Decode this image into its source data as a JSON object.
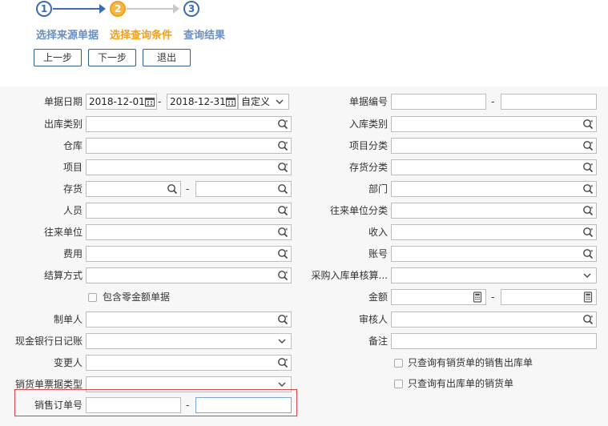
{
  "wizard": {
    "steps": [
      {
        "num": "1",
        "label": "选择来源单据"
      },
      {
        "num": "2",
        "label": "选择查询条件"
      },
      {
        "num": "3",
        "label": "查询结果"
      }
    ],
    "buttons": {
      "prev": "上一步",
      "next": "下一步",
      "exit": "退出"
    }
  },
  "form": {
    "doc_date": {
      "label": "单据日期",
      "from": "2018-12-01",
      "to": "2018-12-31",
      "mode": "自定义",
      "dash": "-"
    },
    "doc_no": {
      "label": "单据编号",
      "dash": "-"
    },
    "out_type": {
      "label": "出库类别"
    },
    "in_type": {
      "label": "入库类别"
    },
    "warehouse": {
      "label": "仓库"
    },
    "project_class": {
      "label": "项目分类"
    },
    "project": {
      "label": "项目"
    },
    "inventory_class": {
      "label": "存货分类"
    },
    "inventory": {
      "label": "存货",
      "dash": "-"
    },
    "department": {
      "label": "部门"
    },
    "person": {
      "label": "人员"
    },
    "partner_class": {
      "label": "往来单位分类"
    },
    "partner": {
      "label": "往来单位"
    },
    "income": {
      "label": "收入"
    },
    "expense": {
      "label": "费用"
    },
    "account": {
      "label": "账号"
    },
    "settle": {
      "label": "结算方式"
    },
    "purchase_check": {
      "label": "采购入库单核算..."
    },
    "include_zero": {
      "label": "包含零金额单据"
    },
    "amount": {
      "label": "金额",
      "dash": "-"
    },
    "maker": {
      "label": "制单人"
    },
    "reviewer": {
      "label": "审核人"
    },
    "cash_journal": {
      "label": "现金银行日记账"
    },
    "remark": {
      "label": "备注"
    },
    "changer": {
      "label": "变更人"
    },
    "only_sales_out": {
      "label": "只查询有销货单的销售出库单"
    },
    "invoice_type": {
      "label": "销货单票据类型"
    },
    "only_out_sales": {
      "label": "只查询有出库单的销货单"
    },
    "sales_order": {
      "label": "销售订单号",
      "dash": "-"
    }
  },
  "colors": {
    "accent": "#3d6db0",
    "active": "#f0a020",
    "highlight": "#d64545"
  }
}
